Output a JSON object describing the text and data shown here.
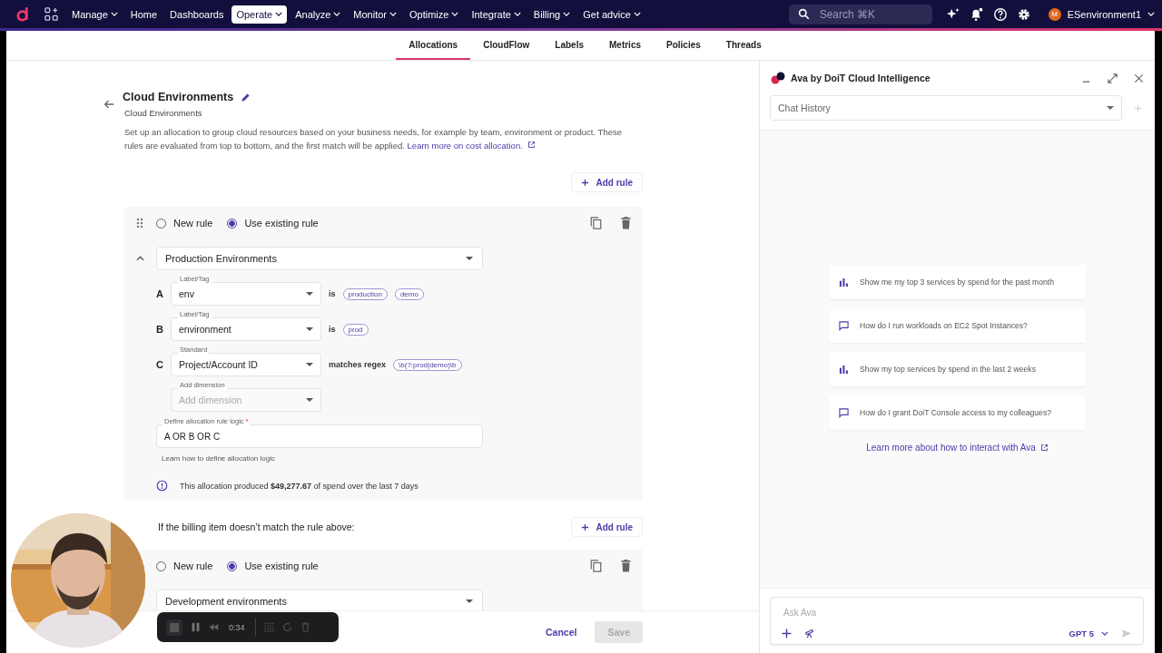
{
  "nav": {
    "items": [
      {
        "label": "Manage",
        "menu": true,
        "selected": false
      },
      {
        "label": "Home",
        "menu": false,
        "selected": false
      },
      {
        "label": "Dashboards",
        "menu": false,
        "selected": false
      },
      {
        "label": "Operate",
        "menu": true,
        "selected": true
      },
      {
        "label": "Analyze",
        "menu": true,
        "selected": false
      },
      {
        "label": "Monitor",
        "menu": true,
        "selected": false
      },
      {
        "label": "Optimize",
        "menu": true,
        "selected": false
      },
      {
        "label": "Integrate",
        "menu": true,
        "selected": false
      },
      {
        "label": "Billing",
        "menu": true,
        "selected": false
      },
      {
        "label": "Get advice",
        "menu": true,
        "selected": false
      }
    ],
    "search": {
      "placeholder": "Search ⌘K"
    },
    "user": {
      "initial": "M",
      "name": "ESenvironment1"
    }
  },
  "subtabs": [
    {
      "label": "Allocations",
      "selected": true
    },
    {
      "label": "CloudFlow",
      "selected": false
    },
    {
      "label": "Labels",
      "selected": false
    },
    {
      "label": "Metrics",
      "selected": false
    },
    {
      "label": "Policies",
      "selected": false
    },
    {
      "label": "Threads",
      "selected": false
    }
  ],
  "header": {
    "title": "Cloud Environments",
    "subtitle": "Cloud Environments",
    "description": "Set up an allocation to group cloud resources based on your business needs, for example by team, environment or product. These rules are evaluated from top to bottom, and the first match will be applied.",
    "link": "Learn more on cost allocation."
  },
  "add_rule": "Add rule",
  "rules": [
    {
      "drag_handle": true,
      "expanded": true,
      "options": [
        {
          "label": "New rule",
          "selected": false
        },
        {
          "label": "Use existing rule",
          "selected": true
        }
      ],
      "rule_name": "Production Environments",
      "conditions": [
        {
          "letter": "A",
          "field_label": "Label/Tag",
          "value": "env",
          "operator": "is",
          "values": [
            "production",
            "demo"
          ]
        },
        {
          "letter": "B",
          "field_label": "Label/Tag",
          "value": "environment",
          "operator": "is",
          "values": [
            "prod"
          ]
        },
        {
          "letter": "C",
          "field_label": "Standard",
          "value": "Project/Account ID",
          "operator": "matches regex",
          "values": [
            "\\b(?:prod|demo)\\b"
          ]
        }
      ],
      "add_dimension": {
        "label": "Add dimension",
        "placeholder": "Add dimension"
      },
      "logic": {
        "label": "Define allocation rule logic",
        "required_mark": "*",
        "value": "A OR B OR C"
      },
      "logic_help": "Learn how to define allocation logic",
      "spend_note": "This allocation produced **$49,277.67** of spend over the last 7 days"
    },
    {
      "options": [
        {
          "label": "New rule",
          "selected": false
        },
        {
          "label": "Use existing rule",
          "selected": true
        }
      ],
      "rule_name": "Development environments"
    }
  ],
  "fallback": {
    "text": "If the billing item doesn’t match the rule above:",
    "button": "Add rule"
  },
  "footer": {
    "cancel": "Cancel",
    "save": "Save",
    "save_disabled": true
  },
  "recorder": {
    "time": "0:34"
  },
  "assistant": {
    "title": "Ava by DoiT Cloud Intelligence",
    "chat_history": {
      "placeholder": "Chat History"
    },
    "suggestions": [
      {
        "kind": "chart",
        "text": "Show me my top 3 services by spend for the past month"
      },
      {
        "kind": "chat",
        "text": "How do I run workloads on EC2 Spot Instances?"
      },
      {
        "kind": "chart",
        "text": "Show my top services by spend in the last 2 weeks"
      },
      {
        "kind": "chat",
        "text": "How do I grant DoiT Console access to my colleagues?"
      }
    ],
    "learn_more": "Learn more about how to interact with Ava",
    "input": {
      "placeholder": "Ask Ava"
    },
    "model": "GPT 5"
  }
}
